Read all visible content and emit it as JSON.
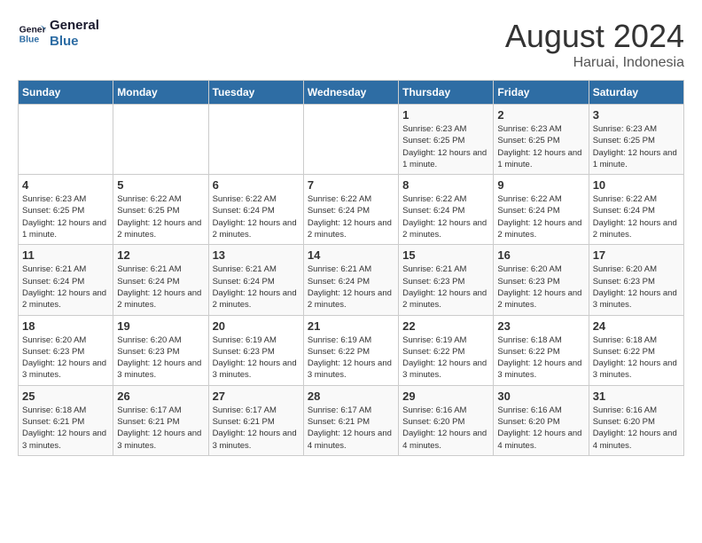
{
  "logo": {
    "line1": "General",
    "line2": "Blue"
  },
  "title": "August 2024",
  "subtitle": "Haruai, Indonesia",
  "weekdays": [
    "Sunday",
    "Monday",
    "Tuesday",
    "Wednesday",
    "Thursday",
    "Friday",
    "Saturday"
  ],
  "weeks": [
    [
      {
        "day": "",
        "info": ""
      },
      {
        "day": "",
        "info": ""
      },
      {
        "day": "",
        "info": ""
      },
      {
        "day": "",
        "info": ""
      },
      {
        "day": "1",
        "info": "Sunrise: 6:23 AM\nSunset: 6:25 PM\nDaylight: 12 hours and 1 minute."
      },
      {
        "day": "2",
        "info": "Sunrise: 6:23 AM\nSunset: 6:25 PM\nDaylight: 12 hours and 1 minute."
      },
      {
        "day": "3",
        "info": "Sunrise: 6:23 AM\nSunset: 6:25 PM\nDaylight: 12 hours and 1 minute."
      }
    ],
    [
      {
        "day": "4",
        "info": "Sunrise: 6:23 AM\nSunset: 6:25 PM\nDaylight: 12 hours and 1 minute."
      },
      {
        "day": "5",
        "info": "Sunrise: 6:22 AM\nSunset: 6:25 PM\nDaylight: 12 hours and 2 minutes."
      },
      {
        "day": "6",
        "info": "Sunrise: 6:22 AM\nSunset: 6:24 PM\nDaylight: 12 hours and 2 minutes."
      },
      {
        "day": "7",
        "info": "Sunrise: 6:22 AM\nSunset: 6:24 PM\nDaylight: 12 hours and 2 minutes."
      },
      {
        "day": "8",
        "info": "Sunrise: 6:22 AM\nSunset: 6:24 PM\nDaylight: 12 hours and 2 minutes."
      },
      {
        "day": "9",
        "info": "Sunrise: 6:22 AM\nSunset: 6:24 PM\nDaylight: 12 hours and 2 minutes."
      },
      {
        "day": "10",
        "info": "Sunrise: 6:22 AM\nSunset: 6:24 PM\nDaylight: 12 hours and 2 minutes."
      }
    ],
    [
      {
        "day": "11",
        "info": "Sunrise: 6:21 AM\nSunset: 6:24 PM\nDaylight: 12 hours and 2 minutes."
      },
      {
        "day": "12",
        "info": "Sunrise: 6:21 AM\nSunset: 6:24 PM\nDaylight: 12 hours and 2 minutes."
      },
      {
        "day": "13",
        "info": "Sunrise: 6:21 AM\nSunset: 6:24 PM\nDaylight: 12 hours and 2 minutes."
      },
      {
        "day": "14",
        "info": "Sunrise: 6:21 AM\nSunset: 6:24 PM\nDaylight: 12 hours and 2 minutes."
      },
      {
        "day": "15",
        "info": "Sunrise: 6:21 AM\nSunset: 6:23 PM\nDaylight: 12 hours and 2 minutes."
      },
      {
        "day": "16",
        "info": "Sunrise: 6:20 AM\nSunset: 6:23 PM\nDaylight: 12 hours and 2 minutes."
      },
      {
        "day": "17",
        "info": "Sunrise: 6:20 AM\nSunset: 6:23 PM\nDaylight: 12 hours and 3 minutes."
      }
    ],
    [
      {
        "day": "18",
        "info": "Sunrise: 6:20 AM\nSunset: 6:23 PM\nDaylight: 12 hours and 3 minutes."
      },
      {
        "day": "19",
        "info": "Sunrise: 6:20 AM\nSunset: 6:23 PM\nDaylight: 12 hours and 3 minutes."
      },
      {
        "day": "20",
        "info": "Sunrise: 6:19 AM\nSunset: 6:23 PM\nDaylight: 12 hours and 3 minutes."
      },
      {
        "day": "21",
        "info": "Sunrise: 6:19 AM\nSunset: 6:22 PM\nDaylight: 12 hours and 3 minutes."
      },
      {
        "day": "22",
        "info": "Sunrise: 6:19 AM\nSunset: 6:22 PM\nDaylight: 12 hours and 3 minutes."
      },
      {
        "day": "23",
        "info": "Sunrise: 6:18 AM\nSunset: 6:22 PM\nDaylight: 12 hours and 3 minutes."
      },
      {
        "day": "24",
        "info": "Sunrise: 6:18 AM\nSunset: 6:22 PM\nDaylight: 12 hours and 3 minutes."
      }
    ],
    [
      {
        "day": "25",
        "info": "Sunrise: 6:18 AM\nSunset: 6:21 PM\nDaylight: 12 hours and 3 minutes."
      },
      {
        "day": "26",
        "info": "Sunrise: 6:17 AM\nSunset: 6:21 PM\nDaylight: 12 hours and 3 minutes."
      },
      {
        "day": "27",
        "info": "Sunrise: 6:17 AM\nSunset: 6:21 PM\nDaylight: 12 hours and 3 minutes."
      },
      {
        "day": "28",
        "info": "Sunrise: 6:17 AM\nSunset: 6:21 PM\nDaylight: 12 hours and 4 minutes."
      },
      {
        "day": "29",
        "info": "Sunrise: 6:16 AM\nSunset: 6:20 PM\nDaylight: 12 hours and 4 minutes."
      },
      {
        "day": "30",
        "info": "Sunrise: 6:16 AM\nSunset: 6:20 PM\nDaylight: 12 hours and 4 minutes."
      },
      {
        "day": "31",
        "info": "Sunrise: 6:16 AM\nSunset: 6:20 PM\nDaylight: 12 hours and 4 minutes."
      }
    ]
  ]
}
